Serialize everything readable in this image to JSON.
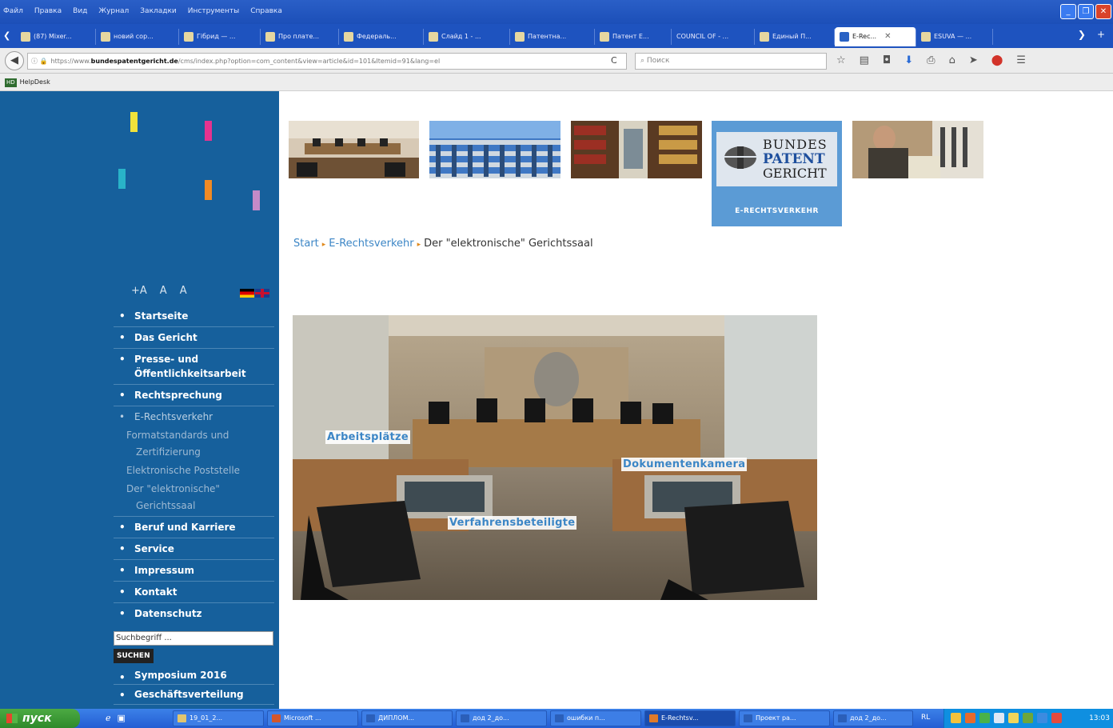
{
  "browser": {
    "menus": [
      "Файл",
      "Правка",
      "Вид",
      "Журнал",
      "Закладки",
      "Инструменты",
      "Справка"
    ],
    "tabs": [
      {
        "label": "(87) Mixer..."
      },
      {
        "label": "новий сор..."
      },
      {
        "label": "Гібрид — ..."
      },
      {
        "label": "Про плате..."
      },
      {
        "label": "Федераль..."
      },
      {
        "label": "Слайд 1 - ..."
      },
      {
        "label": "Патентна..."
      },
      {
        "label": "Патент E..."
      },
      {
        "label": "COUNCIL OF - ..."
      },
      {
        "label": "Единый П..."
      },
      {
        "label": "E-Rec..."
      },
      {
        "label": "ESUVA — ..."
      }
    ],
    "url_prefix": "https://www.",
    "url_domain": "bundespatentgericht.de",
    "url_suffix": "/cms/index.php?option=com_content&view=article&id=101&Itemid=91&lang=el",
    "search_placeholder": "Поиск",
    "bookmark": "HelpDesk",
    "bookmark_icon_text": "HD"
  },
  "sidebar": {
    "font_sizes": [
      "+A",
      "A",
      "A"
    ],
    "nav": [
      {
        "label": "Startseite"
      },
      {
        "label": "Das Gericht"
      },
      {
        "label": "Presse- und Öffentlichkeitsarbeit"
      },
      {
        "label": "Rechtsprechung"
      },
      {
        "label": "E-Rechtsverkehr"
      }
    ],
    "subnav": [
      {
        "label": "Formatstandards und Zertifizierung"
      },
      {
        "label": "Elektronische Poststelle"
      },
      {
        "label": "Der \"elektronische\" Gerichtssaal"
      }
    ],
    "nav_after": [
      {
        "label": "Beruf und Karriere"
      },
      {
        "label": "Service"
      },
      {
        "label": "Impressum"
      },
      {
        "label": "Kontakt"
      },
      {
        "label": "Datenschutz"
      }
    ],
    "search_placeholder": "Suchbegriff ...",
    "search_button": "SUCHEN",
    "nav_bottom": [
      {
        "label": "Symposium 2016"
      },
      {
        "label": "Geschäftsverteilung"
      }
    ],
    "deco_colors": [
      "#f0e23a",
      "#e6338f",
      "#29b3c8",
      "#f08a24",
      "#c48ac8"
    ]
  },
  "logo": {
    "line1": "BUNDES",
    "line2": "PATENT",
    "line3": "GERICHT",
    "sub": "E-RECHTSVERKEHR"
  },
  "breadcrumb": {
    "start": "Start",
    "section": "E-Rechtsverkehr",
    "current": "Der \"elektronische\" Gerichtssaal"
  },
  "photo_labels": {
    "arbeitsplaetze": "Arbeitsplätze",
    "dokumentenkamera": "Dokumentenkamera",
    "verfahrensbeteiligte": "Verfahrensbeteiligte"
  },
  "taskbar": {
    "start": "пуск",
    "tasks": [
      {
        "label": "19_01_2..."
      },
      {
        "label": "Microsoft ..."
      },
      {
        "label": "ДИПЛОМ..."
      },
      {
        "label": "дод 2_до..."
      },
      {
        "label": "ошибки п..."
      },
      {
        "label": "E-Rechtsv..."
      },
      {
        "label": "Проект ра..."
      },
      {
        "label": "дод 2_до..."
      }
    ],
    "lang": "RL",
    "clock": "13:03"
  },
  "colors": {
    "sidebar_bg": "#16609c",
    "link": "#3c86c6",
    "logo_bg": "#5b9bd5",
    "breadcrumb_sep": "#e08a1e"
  }
}
